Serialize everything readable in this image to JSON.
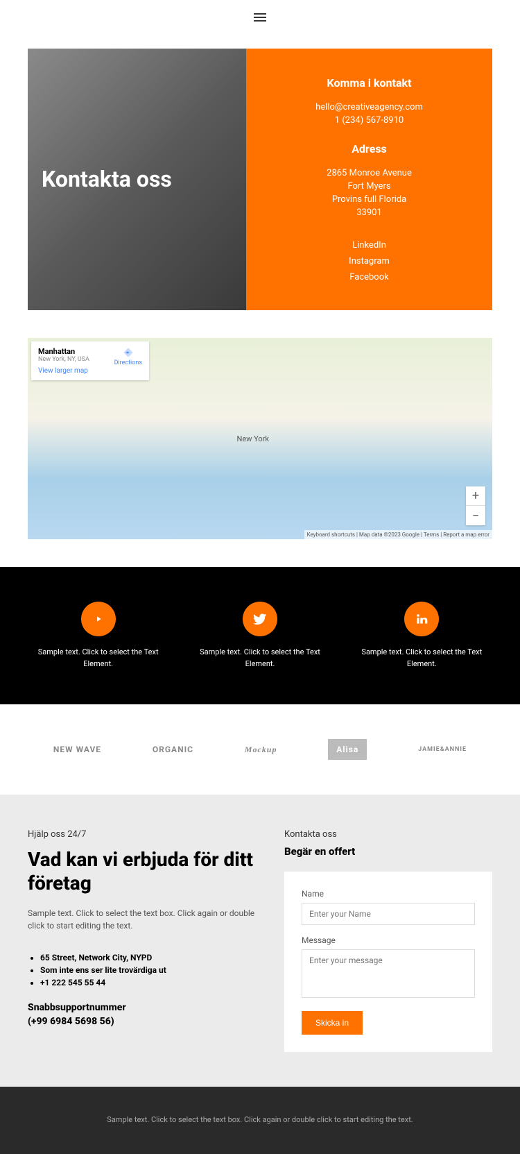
{
  "hero": {
    "title": "Kontakta oss",
    "contact_heading": "Komma i kontakt",
    "email": "hello@creativeagency.com",
    "phone": "1 (234) 567-8910",
    "address_heading": "Adress",
    "addr1": "2865 Monroe Avenue",
    "addr2": "Fort Myers",
    "addr3": "Provins full Florida",
    "addr4": "33901",
    "linkedin": "LinkedIn",
    "instagram": "Instagram",
    "facebook": "Facebook"
  },
  "map": {
    "title": "Manhattan",
    "subtitle": "New York, NY, USA",
    "larger": "View larger map",
    "directions": "Directions",
    "footer": "Keyboard shortcuts | Map data ©2023 Google | Terms | Report a map error",
    "label_ny": "New York"
  },
  "social": {
    "items": [
      {
        "text": "Sample text. Click to select the Text Element."
      },
      {
        "text": "Sample text. Click to select the Text Element."
      },
      {
        "text": "Sample text. Click to select the Text Element."
      }
    ]
  },
  "logos": [
    "NEW WAVE",
    "ORGANIC",
    "Mockup",
    "Alisa",
    "JAMIE&ANNIE"
  ],
  "contact": {
    "left_sub": "Hjälp oss 24/7",
    "left_title": "Vad kan vi erbjuda för ditt företag",
    "left_desc": "Sample text. Click to select the text box. Click again or double click to start editing the text.",
    "bullets": [
      "65 Street, Network City, NYPD",
      "Som inte ens ser lite trovärdiga ut",
      "+1 222 545 55 44"
    ],
    "support1": "Snabbsupportnummer",
    "support2": "(+99 6984 5698 56)",
    "right_sub": "Kontakta oss",
    "right_title": "Begär en offert",
    "name_label": "Name",
    "name_placeholder": "Enter your Name",
    "msg_label": "Message",
    "msg_placeholder": "Enter your message",
    "submit": "Skicka in"
  },
  "footer": {
    "text": "Sample text. Click to select the text box. Click again or double click to start editing the text."
  }
}
